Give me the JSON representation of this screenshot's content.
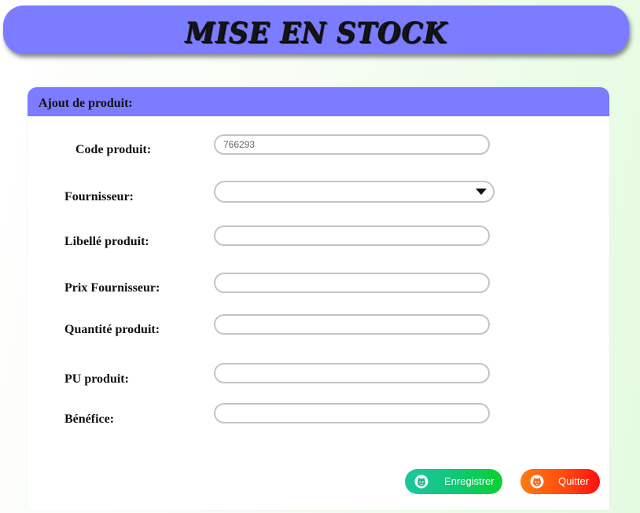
{
  "header": {
    "title": "MISE EN STOCK"
  },
  "form": {
    "section_title": "Ajout de produit:",
    "fields": {
      "code": {
        "label": "Code produit:",
        "placeholder": "766293"
      },
      "fournisseur": {
        "label": "Fournisseur:",
        "value": ""
      },
      "libelle": {
        "label": "Libellé produit:",
        "value": ""
      },
      "prix_fournisseur": {
        "label": "Prix Fournisseur:",
        "value": ""
      },
      "quantite": {
        "label": "Quantité produit:",
        "value": ""
      },
      "pu": {
        "label": "PU produit:",
        "value": ""
      },
      "benefice": {
        "label": "Bénéfice:",
        "value": ""
      }
    }
  },
  "actions": {
    "save_label": "Enregistrer",
    "quit_label": "Quitter",
    "icon": "cat-face-icon"
  },
  "colors": {
    "header_bg": "#7b7cff",
    "save_gradient_start": "#1ec5a0",
    "save_gradient_end": "#0bd02e",
    "quit_gradient_start": "#ff7a10",
    "quit_gradient_end": "#ff1010"
  }
}
